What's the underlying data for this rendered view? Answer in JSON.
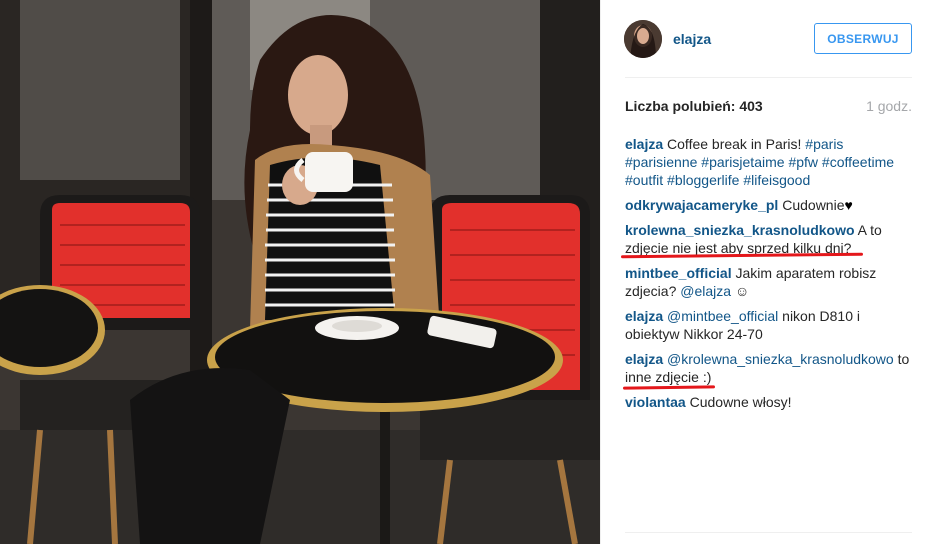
{
  "post": {
    "username": "elajza",
    "follow_label": "OBSERWUJ",
    "likes_text": "Liczba polubień: 403",
    "time_text": "1 godz.",
    "caption": {
      "user": "elajza",
      "text": "Coffee break in Paris!",
      "hashtags": [
        "#paris",
        "#parisienne",
        "#parisjetaime",
        "#pfw",
        "#coffeetime",
        "#outfit",
        "#bloggerlife",
        "#lifeisgood"
      ]
    },
    "comments": [
      {
        "user": "odkrywajacameryke_pl",
        "text": "Cudownie",
        "heart": "♥"
      },
      {
        "user": "krolewna_sniezka_krasnoludkowo",
        "text": "A to zdjęcie nie jest aby sprzed kilku dni?"
      },
      {
        "user": "mintbee_official",
        "text": "Jakim aparatem robisz zdjecia?",
        "mention": "@elajza",
        "emoji": "☺"
      },
      {
        "user": "elajza",
        "mention": "@mintbee_official",
        "text": "nikon D810 i obiektyw Nikkor 24-70"
      },
      {
        "user": "elajza",
        "mention": "@krolewna_sniezka_krasnoludkowo",
        "text": "to inne zdjęcie :)"
      },
      {
        "user": "violantaa",
        "text": "Cudowne włosy!"
      }
    ]
  },
  "colors": {
    "link": "#125688",
    "accent_button": "#3897f0",
    "annotation_red": "#e4171b"
  },
  "icons": {
    "heart": "heart-icon"
  }
}
